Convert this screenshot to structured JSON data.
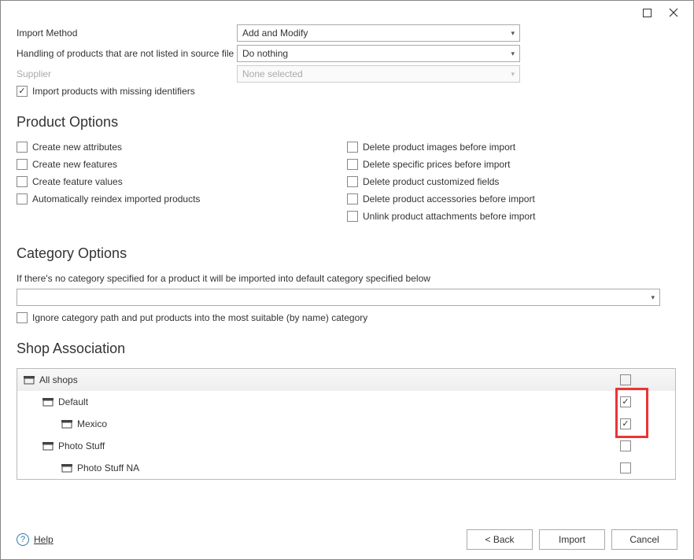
{
  "form": {
    "import_method_label": "Import Method",
    "import_method_value": "Add and Modify",
    "handling_label": "Handling of products that are not listed in source file",
    "handling_value": "Do nothing",
    "supplier_label": "Supplier",
    "supplier_value": "None selected",
    "import_missing_label": "Import products with missing identifiers"
  },
  "sections": {
    "product_options": "Product Options",
    "category_options": "Category Options",
    "shop_association": "Shop Association"
  },
  "product_options_left": [
    "Create new attributes",
    "Create new features",
    "Create feature values",
    "Automatically reindex imported products"
  ],
  "product_options_right": [
    "Delete product images before import",
    "Delete specific prices before import",
    "Delete product customized fields",
    "Delete product accessories before import",
    "Unlink product attachments before import"
  ],
  "category": {
    "description": "If there's no category specified for a product it will be imported into default category specified below",
    "dropdown_value": "",
    "ignore_path_label": "Ignore category path and put products into the most suitable (by name) category"
  },
  "shops": [
    {
      "name": "All shops",
      "indent": 0,
      "checked": false,
      "header": true
    },
    {
      "name": "Default",
      "indent": 1,
      "checked": true,
      "highlight": true
    },
    {
      "name": "Mexico",
      "indent": 2,
      "checked": true,
      "highlight": true
    },
    {
      "name": "Photo Stuff",
      "indent": 1,
      "checked": false
    },
    {
      "name": "Photo Stuff NA",
      "indent": 2,
      "checked": false
    }
  ],
  "footer": {
    "help": "Help",
    "back": "< Back",
    "import": "Import",
    "cancel": "Cancel"
  }
}
